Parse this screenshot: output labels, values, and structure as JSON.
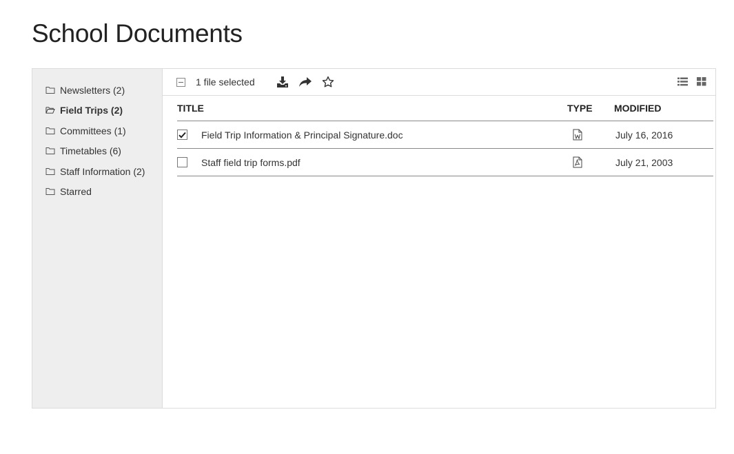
{
  "page": {
    "title": "School Documents"
  },
  "sidebar": {
    "folders": [
      {
        "label": "Newsletters (2)",
        "active": false
      },
      {
        "label": "Field Trips (2)",
        "active": true
      },
      {
        "label": "Committees (1)",
        "active": false
      },
      {
        "label": "Timetables (6)",
        "active": false
      },
      {
        "label": "Staff Information (2)",
        "active": false
      },
      {
        "label": "Starred",
        "active": false
      }
    ]
  },
  "toolbar": {
    "selected_text": "1 file selected",
    "actions": [
      "download-icon",
      "share-icon",
      "star-icon"
    ],
    "views": [
      "list-view-icon",
      "grid-view-icon"
    ]
  },
  "table": {
    "headers": {
      "title": "TITLE",
      "type": "TYPE",
      "modified": "MODIFIED"
    },
    "rows": [
      {
        "checked": true,
        "title": "Field Trip Information & Principal Signature.doc",
        "type": "word-doc-icon",
        "modified": "July 16, 2016"
      },
      {
        "checked": false,
        "title": "Staff field trip forms.pdf",
        "type": "pdf-icon",
        "modified": "July 21, 2003"
      }
    ]
  }
}
